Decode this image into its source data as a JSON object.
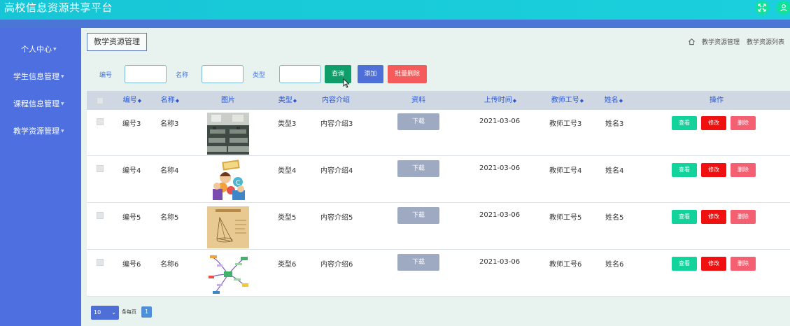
{
  "app": {
    "title": "高校信息资源共享平台"
  },
  "topbar": {
    "expand_icon": "expand-icon",
    "user_icon": "user-icon"
  },
  "sidebar": {
    "items": [
      {
        "label": "个人中心"
      },
      {
        "label": "学生信息管理"
      },
      {
        "label": "课程信息管理"
      },
      {
        "label": "教学资源管理"
      }
    ]
  },
  "page": {
    "title": "教学资源管理"
  },
  "breadcrumb": {
    "items": [
      "教学资源管理",
      "教学资源列表"
    ]
  },
  "search": {
    "fields": [
      {
        "label": "编号",
        "value": ""
      },
      {
        "label": "名称",
        "value": ""
      },
      {
        "label": "类型",
        "value": ""
      }
    ],
    "query_label": "查询",
    "add_label": "添加",
    "batch_delete_label": "批量删除"
  },
  "table": {
    "headers": [
      "编号",
      "名称",
      "图片",
      "类型",
      "内容介绍",
      "资料",
      "上传时间",
      "教师工号",
      "姓名",
      "操作"
    ],
    "sortable": [
      "编号",
      "名称",
      "类型",
      "上传时间",
      "教师工号",
      "姓名"
    ],
    "download_label": "下载",
    "view_label": "查看",
    "edit_label": "修改",
    "delete_label": "删除",
    "rows": [
      {
        "id": "编号3",
        "name": "名称3",
        "image": "classroom-photo",
        "type": "类型3",
        "intro": "内容介绍3",
        "date": "2021-03-06",
        "teacher_no": "教师工号3",
        "teacher_name": "姓名3"
      },
      {
        "id": "编号4",
        "name": "名称4",
        "image": "children-illustration",
        "type": "类型4",
        "intro": "内容介绍4",
        "date": "2021-03-06",
        "teacher_no": "教师工号4",
        "teacher_name": "姓名4"
      },
      {
        "id": "编号5",
        "name": "名称5",
        "image": "geometry-diagram",
        "type": "类型5",
        "intro": "内容介绍5",
        "date": "2021-03-06",
        "teacher_no": "教师工号5",
        "teacher_name": "姓名5"
      },
      {
        "id": "编号6",
        "name": "名称6",
        "image": "mind-map",
        "type": "类型6",
        "intro": "内容介绍6",
        "date": "2021-03-06",
        "teacher_no": "教师工号6",
        "teacher_name": "姓名6"
      }
    ]
  },
  "pagination": {
    "page_size": "10",
    "per_page_label": "条每页",
    "current_page": "1"
  },
  "colors": {
    "topbar": "#17c6d6",
    "sidebar": "#4e6fe0",
    "query_button": "#0f9e6a",
    "add_button": "#4f6fd8",
    "batch_delete_button": "#f55b5b",
    "view_button": "#11d39b",
    "edit_button": "#f01010",
    "delete_button": "#f55f72",
    "download_button": "#9ea9c2"
  }
}
